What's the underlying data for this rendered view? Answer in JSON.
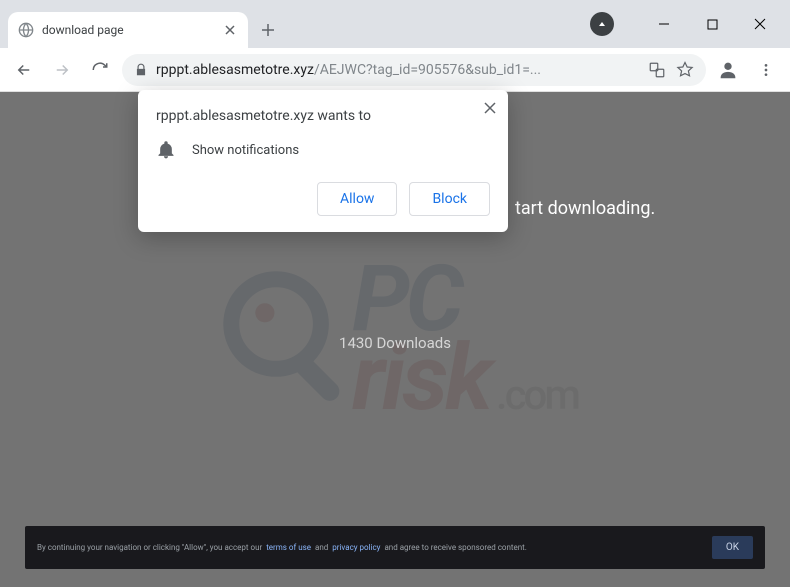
{
  "tab": {
    "title": "download page"
  },
  "omnibox": {
    "host": "rpppt.ablesasmetotre.xyz",
    "path": "/AEJWC?tag_id=905576&sub_id1=..."
  },
  "prompt": {
    "origin": "rpppt.ablesasmetotre.xyz wants to",
    "permission": "Show notifications",
    "allow": "Allow",
    "block": "Block"
  },
  "page": {
    "instruction_fragment": "tart downloading.",
    "downloads": "1430 Downloads"
  },
  "consent": {
    "pre": "By continuing your navigation or clicking \"Allow\", you accept our ",
    "link1": "terms of use",
    "mid": " and ",
    "link2": "privacy policy",
    "post": " and agree to receive sponsored content.",
    "ok": "OK"
  },
  "watermark": {
    "pc": "PC",
    "risk": "risk",
    "com": ".com"
  }
}
